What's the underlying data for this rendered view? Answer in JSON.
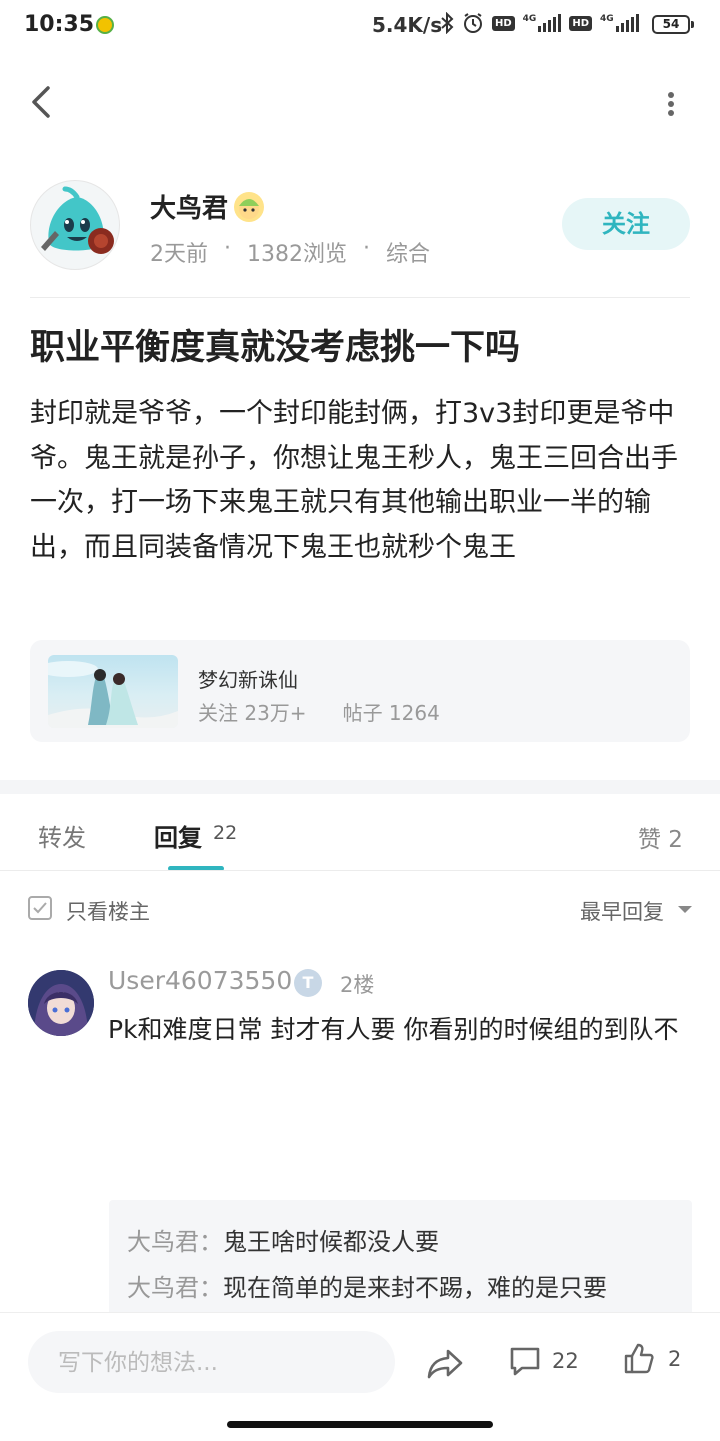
{
  "status_bar": {
    "time": "10:35",
    "net_speed": "5.4K/s",
    "network_label": "4G",
    "hd_label": "HD",
    "battery": "54"
  },
  "author": {
    "name": "大鸟君",
    "time_ago": "2天前",
    "sep": "·",
    "views": "1382浏览",
    "category": "综合",
    "follow_label": "关注"
  },
  "post": {
    "title": "职业平衡度真就没考虑挑一下吗",
    "body": "封印就是爷爷，一个封印能封俩，打3v3封印更是爷中爷。鬼王就是孙子，你想让鬼王秒人，鬼王三回合出手一次，打一场下来鬼王就只有其他输出职业一半的输出，而且同装备情况下鬼王也就秒个鬼王"
  },
  "forum": {
    "name": "梦幻新诛仙",
    "followers": "关注 23万+",
    "posts": "帖子 1264"
  },
  "tabs": {
    "repost": "转发",
    "reply": "回复",
    "reply_count": "22",
    "like": "赞 2"
  },
  "filters": {
    "only_op": "只看楼主",
    "sort": "最早回复"
  },
  "comment": {
    "user": "User46073550",
    "badge": "T",
    "floor": "2楼",
    "text": "Pk和难度日常 封才有人要 你看别的时候组的到队不",
    "replies": [
      {
        "name": "大鸟君",
        "colon": "：",
        "text": "鬼王啥时候都没人要"
      },
      {
        "name": "大鸟君",
        "colon": "：",
        "text": "现在简单的是来封不踢，难的是只要"
      }
    ]
  },
  "bottom": {
    "placeholder": "写下你的想法...",
    "comment_count": "22",
    "like_count": "2"
  },
  "colors": {
    "accent": "#2fb5bf",
    "follow_bg": "#e6f6f7",
    "muted_text": "#999999"
  }
}
